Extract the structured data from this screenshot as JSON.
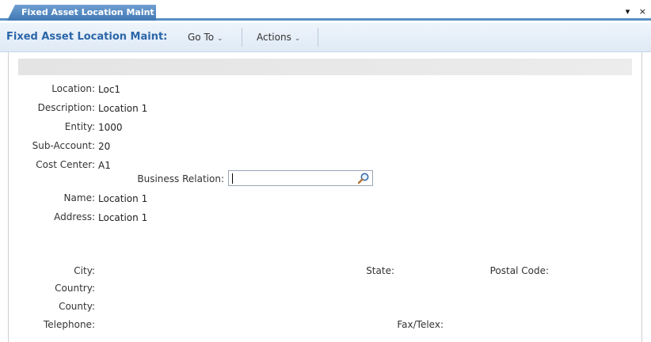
{
  "tab": {
    "label": "Fixed Asset Location Maint",
    "controls": "▾ ×"
  },
  "toolbar": {
    "title": "Fixed Asset Location Maint:",
    "goto_label": "Go To",
    "actions_label": "Actions",
    "caret": "⌄"
  },
  "form": {
    "location": {
      "label": "Location:",
      "value": "Loc1"
    },
    "description": {
      "label": "Description:",
      "value": "Location 1"
    },
    "entity": {
      "label": "Entity:",
      "value": "1000"
    },
    "sub_account": {
      "label": "Sub-Account:",
      "value": "20"
    },
    "cost_center": {
      "label": "Cost Center:",
      "value": "A1"
    },
    "business_relation": {
      "label": "Business Relation:",
      "value": ""
    },
    "name": {
      "label": "Name:",
      "value": "Location 1"
    },
    "address": {
      "label": "Address:",
      "value": "Location 1"
    },
    "city": {
      "label": "City:",
      "value": ""
    },
    "state": {
      "label": "State:",
      "value": ""
    },
    "postal_code": {
      "label": "Postal Code:",
      "value": ""
    },
    "country": {
      "label": "Country:",
      "value": ""
    },
    "county": {
      "label": "County:",
      "value": ""
    },
    "telephone": {
      "label": "Telephone:",
      "value": ""
    },
    "fax": {
      "label": "Fax/Telex:",
      "value": ""
    }
  },
  "colors": {
    "accent": "#2b66a9",
    "tab": "#3f78b4"
  }
}
